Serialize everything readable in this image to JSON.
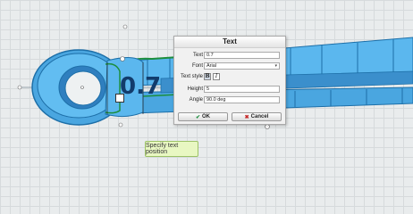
{
  "viewport": {
    "dimension_text": "0.7",
    "tooltip": "Specify text position"
  },
  "dialog": {
    "title": "Text",
    "fields": {
      "text_label": "Text",
      "text_value": "0.7",
      "font_label": "Font",
      "font_value": "Arial",
      "style_label": "Text style",
      "bold_label": "B",
      "italic_label": "I",
      "height_label": "Height",
      "height_value": "5",
      "angle_label": "Angle",
      "angle_value": "90.0 deg"
    },
    "ok_label": "OK",
    "cancel_label": "Cancel"
  },
  "colors": {
    "part_fill": "#5bb7ee",
    "part_stroke": "#1d6fa8",
    "accent": "#1c8e3d",
    "cancel_icon": "#c62828"
  }
}
